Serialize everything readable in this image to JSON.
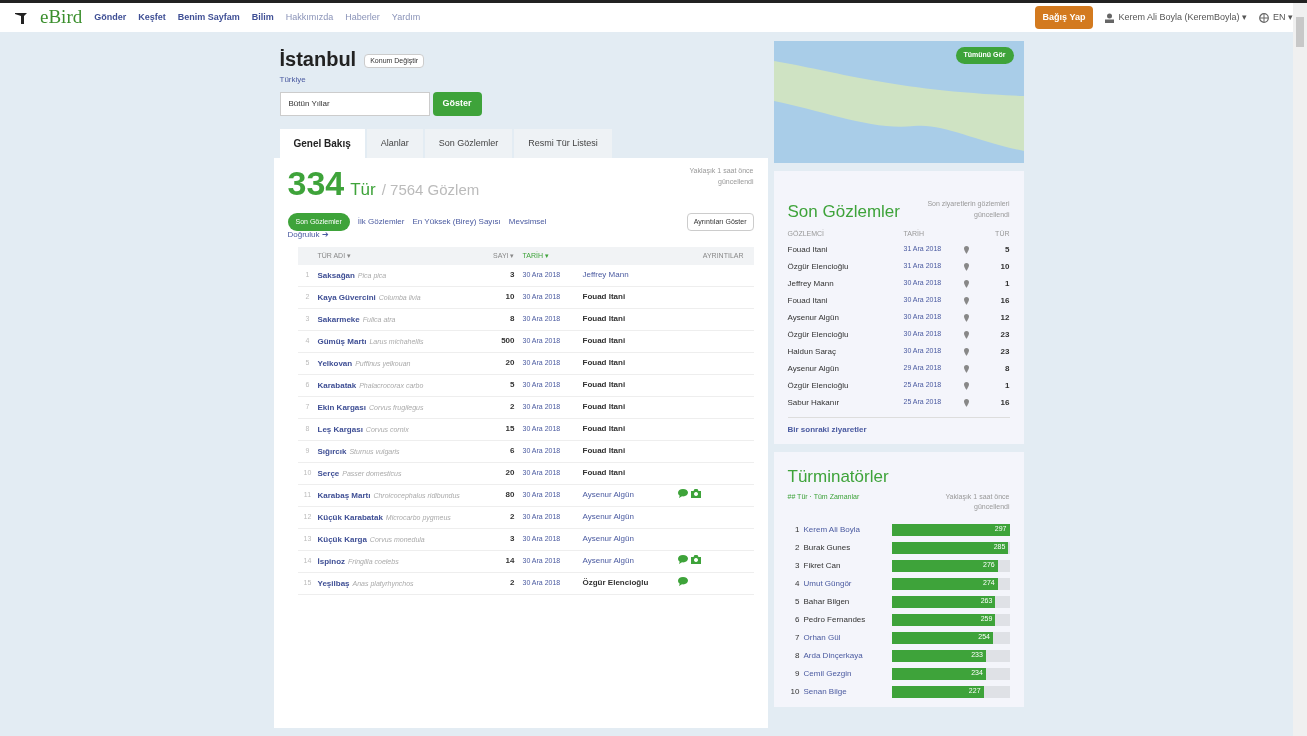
{
  "nav": {
    "logo": "eBird",
    "items": [
      {
        "label": "Gönder",
        "primary": true
      },
      {
        "label": "Keşfet",
        "primary": true
      },
      {
        "label": "Benim Sayfam",
        "primary": true
      },
      {
        "label": "Bilim",
        "primary": true
      },
      {
        "label": "Hakkımızda",
        "primary": false
      },
      {
        "label": "Haberler",
        "primary": false
      },
      {
        "label": "Yardım",
        "primary": false
      }
    ],
    "donate": "Bağış Yap",
    "user": "Kerem Ali Boyla (KeremBoyla) ▾",
    "language": "EN ▾"
  },
  "region": {
    "title": "İstanbul",
    "change_button": "Konum Değiştir",
    "parent": "Türkiye",
    "year_select": "Bütün Yıllar",
    "go_button": "Göster"
  },
  "tabs": [
    {
      "label": "Genel Bakış",
      "selected": true
    },
    {
      "label": "Alanlar",
      "selected": false
    },
    {
      "label": "Son Gözlemler",
      "selected": false
    },
    {
      "label": "Resmi Tür Listesi",
      "selected": false
    }
  ],
  "summary": {
    "species_count": "334",
    "species_label": "Tür",
    "observations": "/ 7564 Gözlem",
    "updated": "Yaklaşık 1 saat önce güncellendi"
  },
  "subtabs": [
    {
      "label": "Son Gözlemler",
      "selected": true
    },
    {
      "label": "İlk Gözlemler",
      "selected": false
    },
    {
      "label": "En Yüksek (Birey) Sayısı",
      "selected": false
    },
    {
      "label": "Mevsimsel",
      "selected": false
    }
  ],
  "accuracy_link": "Doğruluk ➔",
  "details_button": "Ayrıntıları Göster",
  "table": {
    "columns": [
      {
        "label": "TÜR ADI ▾",
        "sorted": false
      },
      {
        "label": "SAYI ▾",
        "sorted": false
      },
      {
        "label": "TARİH ▾",
        "sorted": true
      },
      {
        "label": "AYRINTILAR",
        "sorted": false
      }
    ],
    "rows": [
      {
        "num": "1",
        "name": "Saksağan",
        "sci": "Pica pica",
        "count": "3",
        "date": "30 Ara 2018",
        "observer": "Jeffrey Mann",
        "observer_linked": true,
        "comment": false,
        "photo": false
      },
      {
        "num": "2",
        "name": "Kaya Güvercini",
        "sci": "Columba livia",
        "count": "10",
        "date": "30 Ara 2018",
        "observer": "Fouad Itani",
        "observer_linked": false,
        "comment": false,
        "photo": false
      },
      {
        "num": "3",
        "name": "Sakarmeke",
        "sci": "Fulica atra",
        "count": "8",
        "date": "30 Ara 2018",
        "observer": "Fouad Itani",
        "observer_linked": false,
        "comment": false,
        "photo": false
      },
      {
        "num": "4",
        "name": "Gümüş Martı",
        "sci": "Larus michahellis",
        "count": "500",
        "date": "30 Ara 2018",
        "observer": "Fouad Itani",
        "observer_linked": false,
        "comment": false,
        "photo": false
      },
      {
        "num": "5",
        "name": "Yelkovan",
        "sci": "Puffinus yelkouan",
        "count": "20",
        "date": "30 Ara 2018",
        "observer": "Fouad Itani",
        "observer_linked": false,
        "comment": false,
        "photo": false
      },
      {
        "num": "6",
        "name": "Karabatak",
        "sci": "Phalacrocorax carbo",
        "count": "5",
        "date": "30 Ara 2018",
        "observer": "Fouad Itani",
        "observer_linked": false,
        "comment": false,
        "photo": false
      },
      {
        "num": "7",
        "name": "Ekin Kargası",
        "sci": "Corvus frugilegus",
        "count": "2",
        "date": "30 Ara 2018",
        "observer": "Fouad Itani",
        "observer_linked": false,
        "comment": false,
        "photo": false
      },
      {
        "num": "8",
        "name": "Leş Kargası",
        "sci": "Corvus cornix",
        "count": "15",
        "date": "30 Ara 2018",
        "observer": "Fouad Itani",
        "observer_linked": false,
        "comment": false,
        "photo": false
      },
      {
        "num": "9",
        "name": "Sığırcık",
        "sci": "Sturnus vulgaris",
        "count": "6",
        "date": "30 Ara 2018",
        "observer": "Fouad Itani",
        "observer_linked": false,
        "comment": false,
        "photo": false
      },
      {
        "num": "10",
        "name": "Serçe",
        "sci": "Passer domesticus",
        "count": "20",
        "date": "30 Ara 2018",
        "observer": "Fouad Itani",
        "observer_linked": false,
        "comment": false,
        "photo": false
      },
      {
        "num": "11",
        "name": "Karabaş Martı",
        "sci": "Chroicocephalus ridibundus",
        "count": "80",
        "date": "30 Ara 2018",
        "observer": "Aysenur Algün",
        "observer_linked": true,
        "comment": true,
        "photo": true
      },
      {
        "num": "12",
        "name": "Küçük Karabatak",
        "sci": "Microcarbo pygmeus",
        "count": "2",
        "date": "30 Ara 2018",
        "observer": "Aysenur Algün",
        "observer_linked": true,
        "comment": false,
        "photo": false
      },
      {
        "num": "13",
        "name": "Küçük Karga",
        "sci": "Corvus monedula",
        "count": "3",
        "date": "30 Ara 2018",
        "observer": "Aysenur Algün",
        "observer_linked": true,
        "comment": false,
        "photo": false
      },
      {
        "num": "14",
        "name": "İspinoz",
        "sci": "Fringilla coelebs",
        "count": "14",
        "date": "30 Ara 2018",
        "observer": "Aysenur Algün",
        "observer_linked": true,
        "comment": true,
        "photo": true
      },
      {
        "num": "15",
        "name": "Yeşilbaş",
        "sci": "Anas platyrhynchos",
        "count": "2",
        "date": "30 Ara 2018",
        "observer": "Özgür Elencioğlu",
        "observer_linked": false,
        "comment": true,
        "photo": false
      }
    ]
  },
  "map": {
    "button": "Tümünü Gör"
  },
  "recent": {
    "title": "Son Gözlemler",
    "note": "Son ziyaretlerin gözlemleri güncellendi",
    "columns": [
      "GÖZLEMCİ",
      "TARİH",
      "TÜR"
    ],
    "rows": [
      {
        "observer": "Fouad Itani",
        "date": "31 Ara 2018",
        "species": "5"
      },
      {
        "observer": "Özgür Elencioğlu",
        "date": "31 Ara 2018",
        "species": "10"
      },
      {
        "observer": "Jeffrey Mann",
        "date": "30 Ara 2018",
        "species": "1"
      },
      {
        "observer": "Fouad Itani",
        "date": "30 Ara 2018",
        "species": "16"
      },
      {
        "observer": "Aysenur Algün",
        "date": "30 Ara 2018",
        "species": "12"
      },
      {
        "observer": "Özgür Elencioğlu",
        "date": "30 Ara 2018",
        "species": "23"
      },
      {
        "observer": "Haldun Saraç",
        "date": "30 Ara 2018",
        "species": "23"
      },
      {
        "observer": "Aysenur Algün",
        "date": "29 Ara 2018",
        "species": "8"
      },
      {
        "observer": "Özgür Elencioğlu",
        "date": "25 Ara 2018",
        "species": "1"
      },
      {
        "observer": "Sabur Hakanır",
        "date": "25 Ara 2018",
        "species": "16"
      }
    ],
    "more_link": "Bir sonraki ziyaretler"
  },
  "leaders": {
    "title": "Türminatörler",
    "subtitle": "## Tür · Tüm Zamanlar",
    "note": "Yaklaşık 1 saat önce güncellendi",
    "rows": [
      {
        "rank": "1",
        "name": "Kerem Ali Boyla",
        "linked": true,
        "value": "297",
        "level": 1.0
      },
      {
        "rank": "2",
        "name": "Burak Gunes",
        "linked": false,
        "value": "285",
        "level": 0.99
      },
      {
        "rank": "3",
        "name": "Fikret Can",
        "linked": false,
        "value": "276",
        "level": 0.9
      },
      {
        "rank": "4",
        "name": "Umut Güngör",
        "linked": true,
        "value": "274",
        "level": 0.9
      },
      {
        "rank": "5",
        "name": "Bahar Bilgen",
        "linked": false,
        "value": "263",
        "level": 0.88
      },
      {
        "rank": "6",
        "name": "Pedro Fernandes",
        "linked": false,
        "value": "259",
        "level": 0.88
      },
      {
        "rank": "7",
        "name": "Orhan Gül",
        "linked": true,
        "value": "254",
        "level": 0.86
      },
      {
        "rank": "8",
        "name": "Arda Dinçerkaya",
        "linked": true,
        "value": "233",
        "level": 0.8
      },
      {
        "rank": "9",
        "name": "Cemil Gezgin",
        "linked": true,
        "value": "234",
        "level": 0.8
      },
      {
        "rank": "10",
        "name": "Senan Bilge",
        "linked": true,
        "value": "227",
        "level": 0.78
      }
    ]
  }
}
